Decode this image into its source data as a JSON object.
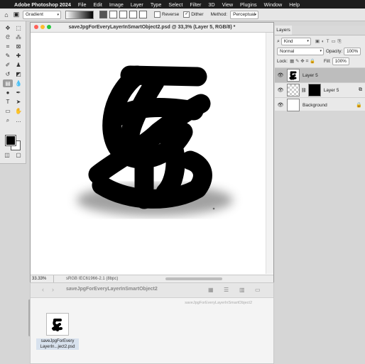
{
  "menubar": {
    "app_name": "Adobe Photoshop 2024",
    "items": [
      "File",
      "Edit",
      "Image",
      "Layer",
      "Type",
      "Select",
      "Filter",
      "3D",
      "View",
      "Plugins",
      "Window",
      "Help"
    ]
  },
  "options_bar": {
    "tool_preset": "Gradient",
    "reverse_label": "Reverse",
    "dither_label": "Dither",
    "dither_checked": true,
    "reverse_checked": false,
    "method_label": "Method:",
    "method_value": "Perceptual"
  },
  "document": {
    "title": "saveJpgForEveryLayerInSmartObject2.psd @ 33,3% (Layer 5, RGB/8) *",
    "zoom": "33.33%",
    "profile": "sRGB IEC61966-2.1 (8bpc)"
  },
  "colors": {
    "foreground": "#000000",
    "background": "#ffffff"
  },
  "layers_panel": {
    "tab_label": "Layers",
    "filter_kind": "Kind",
    "blend_mode": "Normal",
    "opacity_label": "Opacity:",
    "opacity_value": "100%",
    "lock_label": "Lock:",
    "fill_label": "Fill:",
    "fill_value": "100%",
    "layers": [
      {
        "name": "Layer 5",
        "selected": true
      },
      {
        "name": "Layer 5",
        "selected": false
      },
      {
        "name": "Background",
        "selected": false
      }
    ]
  },
  "bridge": {
    "folder_title": "saveJpgForEveryLayerInSmartObject2",
    "path_text": "saveJpgForEveryLayerInSmartObject2",
    "file_name_line1": "saveJpgForEvery",
    "file_name_line2": "LayerIn...ject2.psd"
  }
}
